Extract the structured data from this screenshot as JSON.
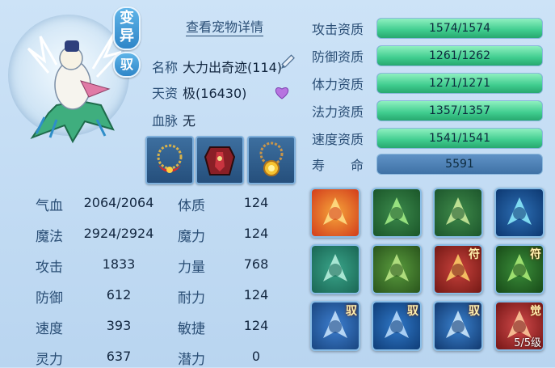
{
  "header": {
    "view_details": "查看宠物详情"
  },
  "tags": {
    "mutation": "变异",
    "tame": "驭"
  },
  "pet": {
    "name_label": "名称",
    "name": "大力出奇迹(114)",
    "aptitude_label": "天资",
    "aptitude": "极(16430)",
    "bloodline_label": "血脉",
    "bloodline": "无"
  },
  "stats": [
    {
      "label": "气血",
      "value": "2064/2064"
    },
    {
      "label": "体质",
      "value": "124"
    },
    {
      "label": "魔法",
      "value": "2924/2924"
    },
    {
      "label": "魔力",
      "value": "124"
    },
    {
      "label": "攻击",
      "value": "1833"
    },
    {
      "label": "力量",
      "value": "768"
    },
    {
      "label": "防御",
      "value": "612"
    },
    {
      "label": "耐力",
      "value": "124"
    },
    {
      "label": "速度",
      "value": "393"
    },
    {
      "label": "敏捷",
      "value": "124"
    },
    {
      "label": "灵力",
      "value": "637"
    },
    {
      "label": "潜力",
      "value": "0"
    }
  ],
  "qualities": [
    {
      "label": "攻击资质",
      "value": "1574/1574",
      "fraction": 1.0
    },
    {
      "label": "防御资质",
      "value": "1261/1262",
      "fraction": 0.999
    },
    {
      "label": "体力资质",
      "value": "1271/1271",
      "fraction": 1.0
    },
    {
      "label": "法力资质",
      "value": "1357/1357",
      "fraction": 1.0
    },
    {
      "label": "速度资质",
      "value": "1541/1541",
      "fraction": 1.0
    }
  ],
  "life": {
    "label": "寿　　命",
    "value": "5591"
  },
  "skills": [
    {
      "icon": "flame-sword-icon"
    },
    {
      "icon": "green-monster-icon"
    },
    {
      "icon": "shield-warrior-icon"
    },
    {
      "icon": "blue-flame-icon"
    },
    {
      "icon": "green-shield-icon"
    },
    {
      "icon": "green-giant-icon"
    },
    {
      "icon": "red-talisman-icon",
      "corner": "符"
    },
    {
      "icon": "green-warrior-icon",
      "corner": "符"
    },
    {
      "icon": "blue-shield-icon",
      "corner": "驭"
    },
    {
      "icon": "blue-boot-icon",
      "corner": "驭"
    },
    {
      "icon": "blue-sword-icon",
      "corner": "驭"
    },
    {
      "icon": "red-awaken-icon",
      "corner": "觉",
      "level": "5/5级"
    }
  ],
  "colors": {
    "bar_fill": "#3fcc8e",
    "text": "#2a4e75",
    "panel": "#c6ddf3"
  }
}
